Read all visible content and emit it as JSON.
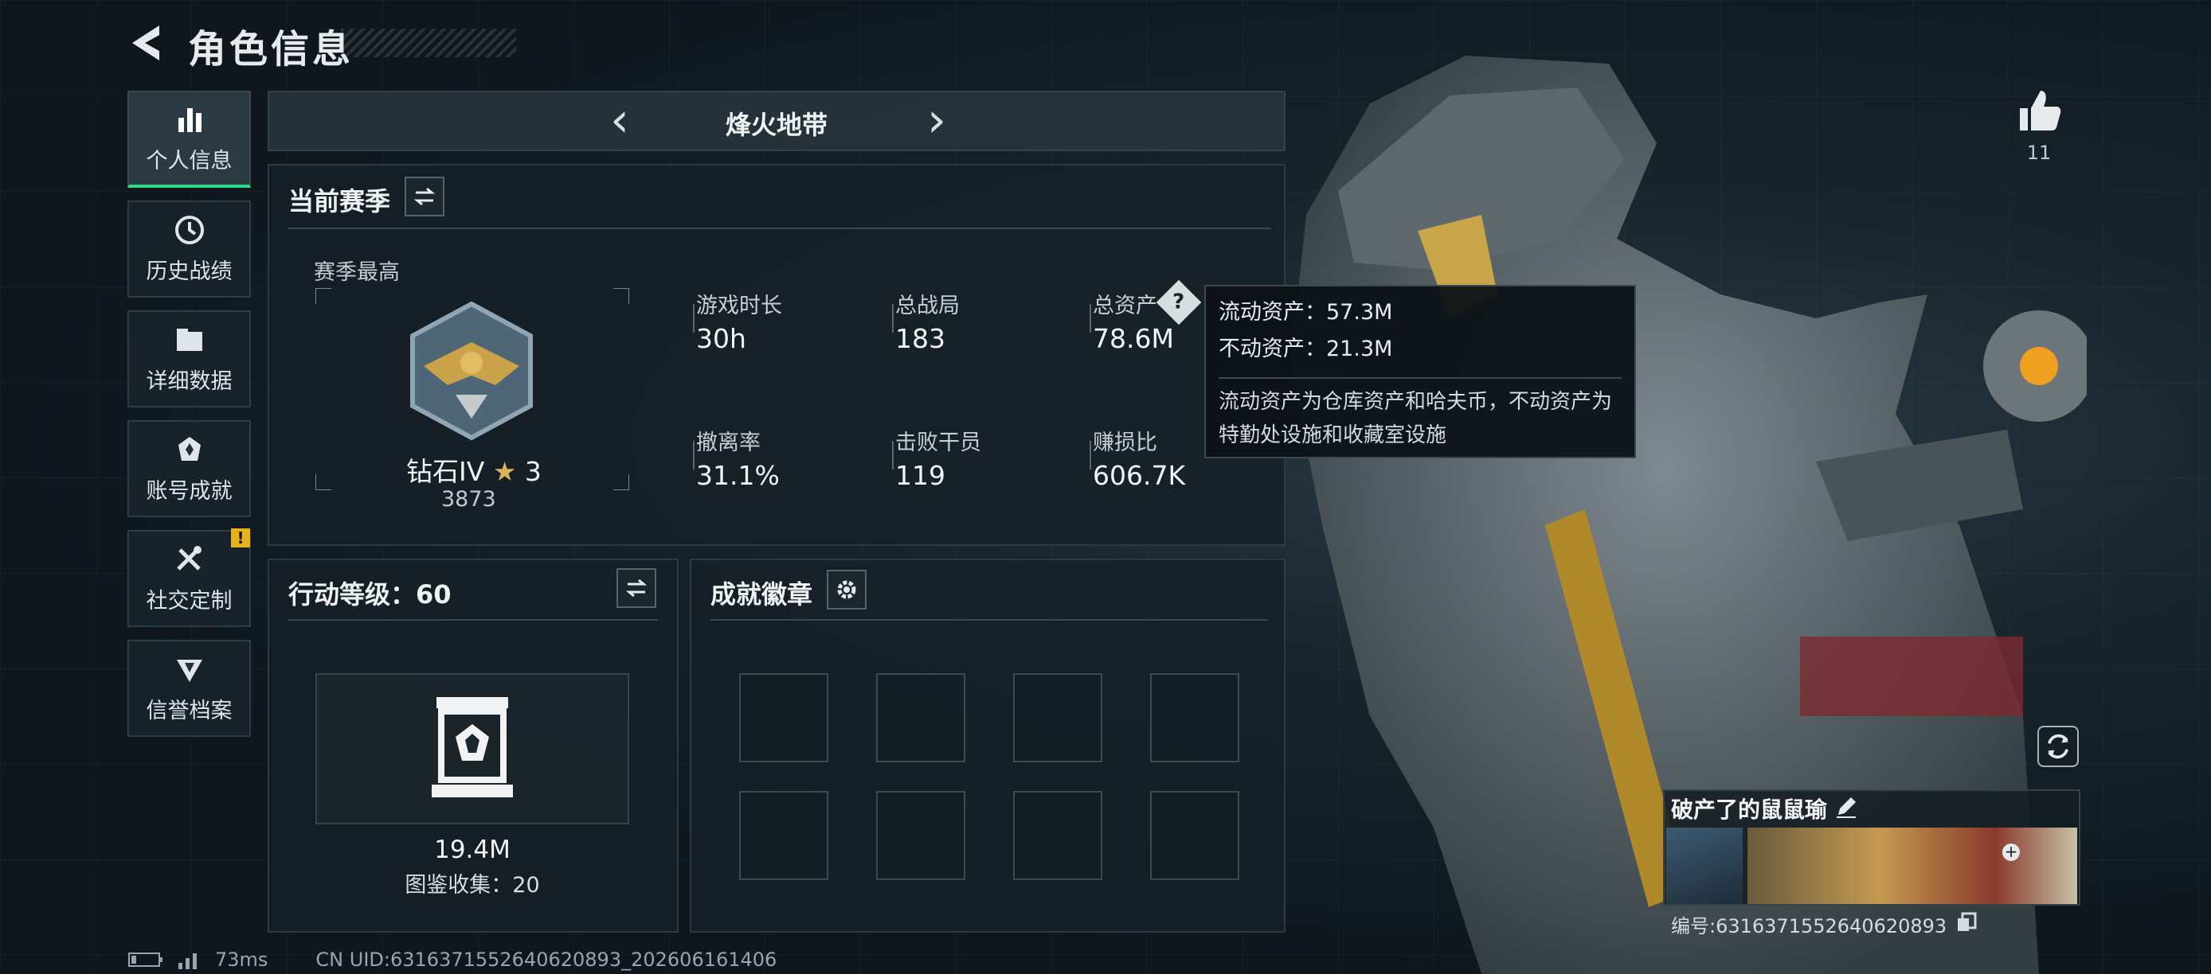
{
  "header": {
    "title": "角色信息"
  },
  "sidebar": {
    "items": [
      {
        "label": "个人信息",
        "icon": "bar-chart-icon",
        "active": true
      },
      {
        "label": "历史战绩",
        "icon": "clock-icon"
      },
      {
        "label": "详细数据",
        "icon": "folder-icon"
      },
      {
        "label": "账号成就",
        "icon": "medal-icon"
      },
      {
        "label": "社交定制",
        "icon": "tools-icon",
        "badge": "!"
      },
      {
        "label": "信誉档案",
        "icon": "shield-icon"
      }
    ]
  },
  "mode": {
    "name": "烽火地带"
  },
  "season": {
    "title": "当前赛季",
    "best_label": "赛季最高",
    "rank_name": "钻石IV",
    "rank_stars": "3",
    "rank_score": "3873",
    "stats": [
      {
        "label": "游戏时长",
        "value": "30h"
      },
      {
        "label": "总战局",
        "value": "183"
      },
      {
        "label": "总资产",
        "value": "78.6M"
      },
      {
        "label": "撤离率",
        "value": "31.1%"
      },
      {
        "label": "击败干员",
        "value": "119"
      },
      {
        "label": "赚损比",
        "value": "606.7K"
      }
    ]
  },
  "tooltip": {
    "liquid": "流动资产：57.3M",
    "fixed": "不动资产：21.3M",
    "desc": "流动资产为仓库资产和哈夫币，不动资产为特勤处设施和收藏室设施"
  },
  "level": {
    "title": "行动等级：60",
    "value": "19.4M",
    "collection": "图鉴收集：20"
  },
  "badges": {
    "title": "成就徽章"
  },
  "profile": {
    "likes": "11",
    "name": "破产了的鼠鼠瑜",
    "id": "编号:6316371552640620893"
  },
  "footer": {
    "ping": "73ms",
    "uid": "CN UID:6316371552640620893_202606161406"
  },
  "colors": {
    "accent": "#2fd98a",
    "warning": "#e7b31d"
  }
}
